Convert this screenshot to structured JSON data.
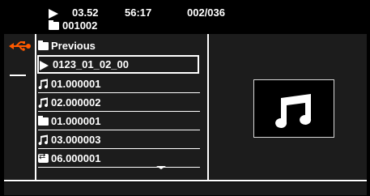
{
  "status": {
    "play_icon": "play-icon",
    "elapsed": "03.52",
    "total": "56:17",
    "track": "002/036",
    "folder_icon": "folder-icon",
    "folder": "001002"
  },
  "sidebar": {
    "source_icon": "usb-icon"
  },
  "list": {
    "items": [
      {
        "icon": "folder-icon",
        "label": "Previous"
      },
      {
        "icon": "play-icon",
        "label": "0123_01_02_00",
        "selected": true
      },
      {
        "icon": "music-note-icon",
        "label": "01.000001"
      },
      {
        "icon": "music-note-icon",
        "label": "02.000002"
      },
      {
        "icon": "folder-icon",
        "label": "01.000001"
      },
      {
        "icon": "music-note-icon",
        "label": "03.000003"
      },
      {
        "icon": "repeat-icon",
        "label": "06.000001"
      }
    ],
    "scroll_indicator": "chevron-down-icon"
  },
  "preview": {
    "icon": "music-note-icon"
  },
  "colors": {
    "background": "#000000",
    "panel": "#1c1c1c",
    "text": "#ffffff",
    "preview_border": "#d8d8d8"
  }
}
